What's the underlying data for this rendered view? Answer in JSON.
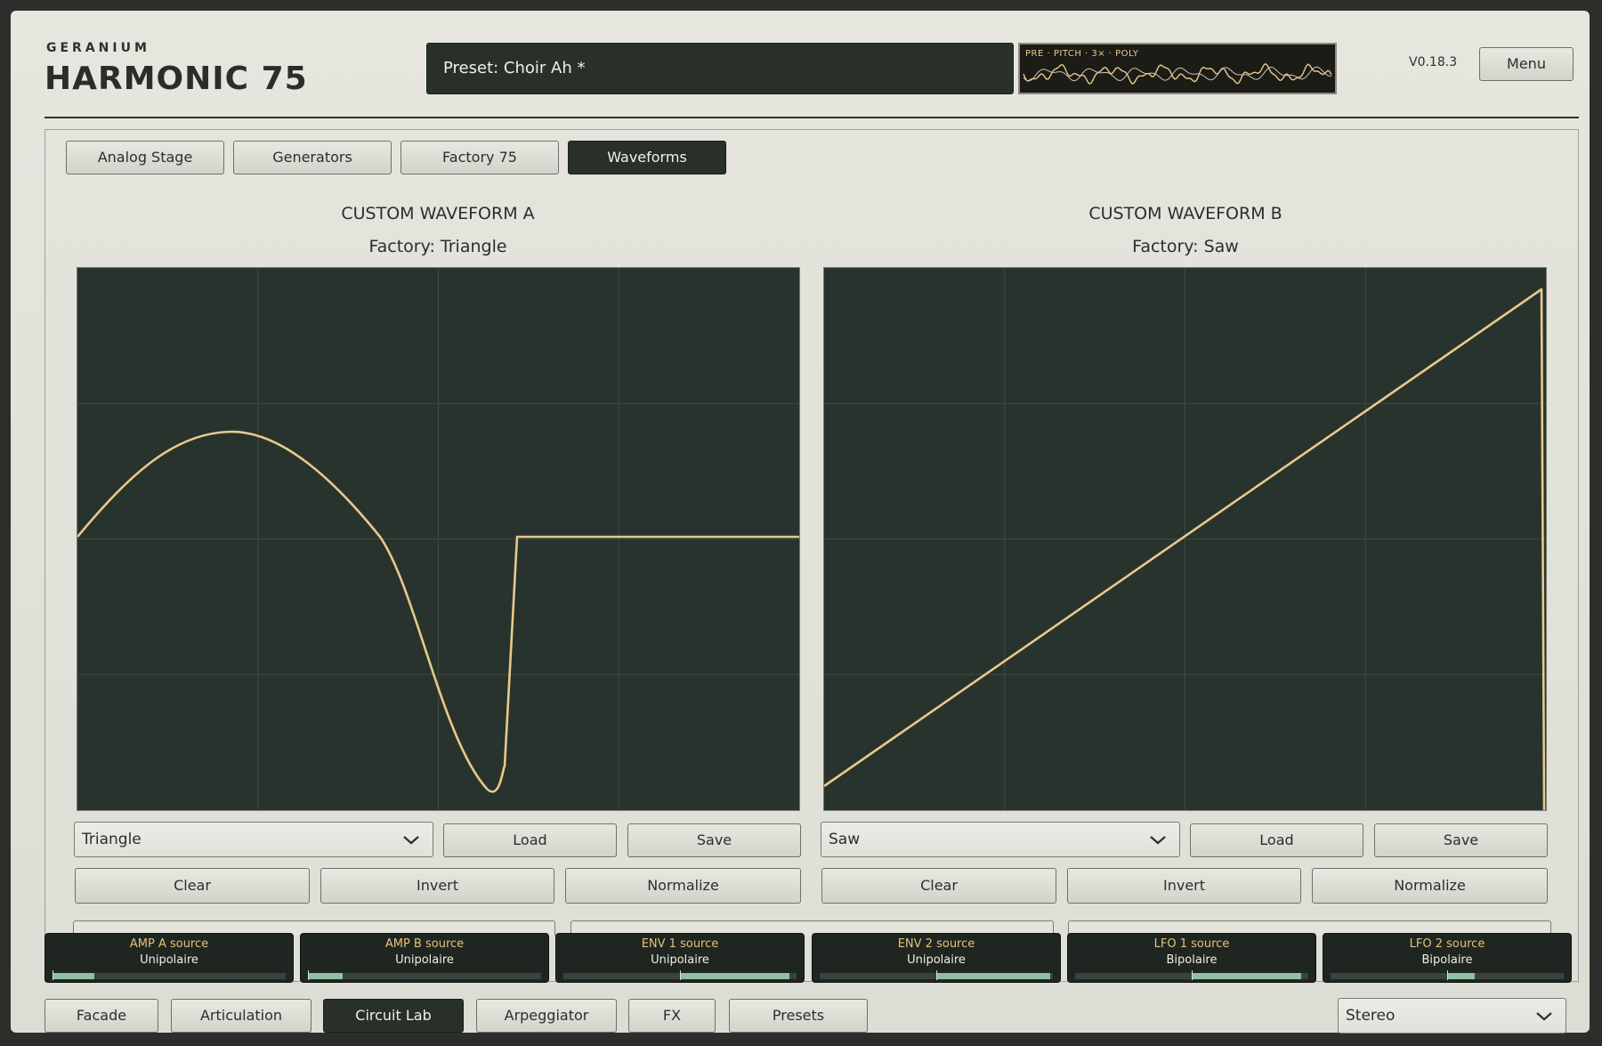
{
  "brand": {
    "company": "GERANIUM",
    "product": "HARMONIC 75"
  },
  "preset": {
    "label": "Preset: Choir Ah *"
  },
  "scope": {
    "label": "PRE · PITCH · 3× · POLY",
    "color": "#e8c98a"
  },
  "version": "V0.18.3",
  "menu_label": "Menu",
  "tabs": [
    {
      "label": "Analog Stage",
      "active": false
    },
    {
      "label": "Generators",
      "active": false
    },
    {
      "label": "Factory 75",
      "active": false
    },
    {
      "label": "Waveforms",
      "active": true
    }
  ],
  "waveforms": [
    {
      "title": "CUSTOM WAVEFORM A",
      "subtitle": "Factory: Triangle",
      "select": "Triangle",
      "load": "Load",
      "save": "Save",
      "clear": "Clear",
      "invert": "Invert",
      "normalize": "Normalize"
    },
    {
      "title": "CUSTOM WAVEFORM B",
      "subtitle": "Factory: Saw",
      "select": "Saw",
      "load": "Load",
      "save": "Save",
      "clear": "Clear",
      "invert": "Invert",
      "normalize": "Normalize"
    }
  ],
  "mod_sources": [
    {
      "label": "AMP A source",
      "value": "Unipolaire",
      "level": 0.18,
      "center": 0.0
    },
    {
      "label": "AMP B source",
      "value": "Unipolaire",
      "level": 0.15,
      "center": 0.0
    },
    {
      "label": "ENV 1 source",
      "value": "Unipolaire",
      "level": 0.47,
      "center": 0.5
    },
    {
      "label": "ENV 2 source",
      "value": "Unipolaire",
      "level": 0.49,
      "center": 0.5
    },
    {
      "label": "LFO 1 source",
      "value": "Bipolaire",
      "level": 0.47,
      "center": 0.5
    },
    {
      "label": "LFO 2 source",
      "value": "Bipolaire",
      "level": 0.12,
      "center": 0.5
    }
  ],
  "bottom_nav": [
    {
      "label": "Facade",
      "active": false
    },
    {
      "label": "Articulation",
      "active": false
    },
    {
      "label": "Circuit Lab",
      "active": true
    },
    {
      "label": "Arpeggiator",
      "active": false
    },
    {
      "label": "FX",
      "active": false
    },
    {
      "label": "Presets",
      "active": false
    }
  ],
  "output_mode": "Stereo",
  "colors": {
    "accent": "#e8c98a",
    "dark": "#283029",
    "graph_bg": "#28332e",
    "meter": "#8fbfa4"
  },
  "icons": {
    "dropdown": "chevron-down-icon"
  }
}
